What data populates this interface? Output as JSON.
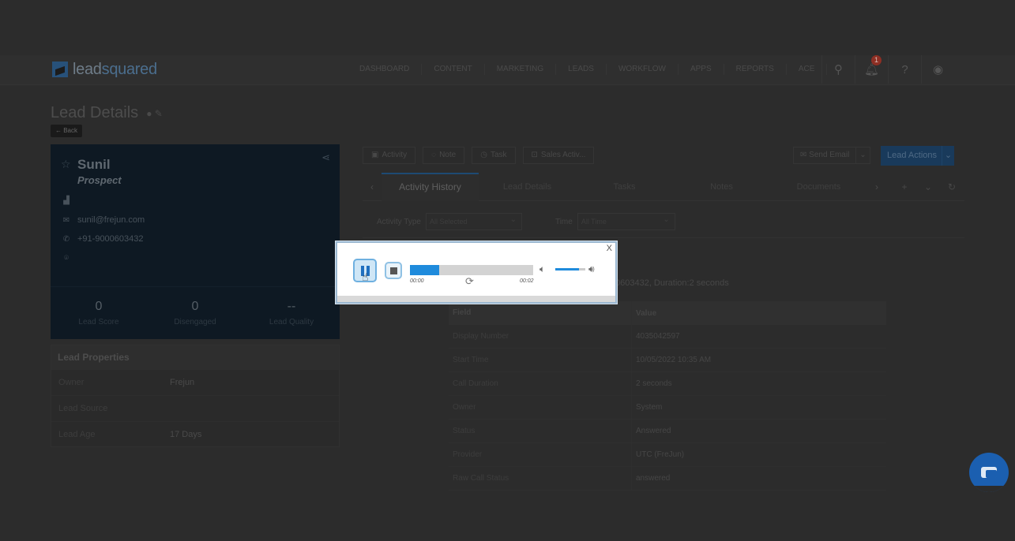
{
  "app": {
    "brand_left": "lead",
    "brand_right": "squared"
  },
  "nav": {
    "items": [
      "DASHBOARD",
      "CONTENT",
      "MARKETING",
      "LEADS",
      "WORKFLOW",
      "APPS",
      "REPORTS",
      "ACE"
    ],
    "notification_count": "1"
  },
  "page": {
    "title": "Lead Details",
    "back_label": "Back"
  },
  "lead": {
    "name": "Sunil",
    "stage": "Prospect",
    "email": "sunil@frejun.com",
    "phone": "+91-9000603432",
    "stats": [
      {
        "value": "0",
        "label": "Lead Score"
      },
      {
        "value": "0",
        "label": "Disengaged"
      },
      {
        "value": "--",
        "label": "Lead Quality"
      }
    ]
  },
  "properties": {
    "header": "Lead Properties",
    "rows": [
      {
        "label": "Owner",
        "value": "Frejun"
      },
      {
        "label": "Lead Source",
        "value": ""
      },
      {
        "label": "Lead Age",
        "value": "17 Days"
      }
    ]
  },
  "toolbar": {
    "activity": "Activity",
    "note": "Note",
    "task": "Task",
    "sales_activity": "Sales Activ...",
    "send_email": "Send Email",
    "lead_actions": "Lead Actions"
  },
  "tabs": [
    "Activity History",
    "Lead Details",
    "Tasks",
    "Notes",
    "Documents"
  ],
  "filters": {
    "activity_type_label": "Activity Type",
    "activity_type_value": "All Selected",
    "time_label": "Time",
    "time_value": "All Time"
  },
  "call": {
    "summary_fragment": "0603432, Duration:2 seconds",
    "table_header": {
      "field": "Field",
      "value": "Value"
    },
    "rows": [
      {
        "field": "Display Number",
        "value": "4035042597"
      },
      {
        "field": "Start Time",
        "value": "10/05/2022 10:35 AM"
      },
      {
        "field": "Call Duration",
        "value": "2 seconds"
      },
      {
        "field": "Owner",
        "value": "System"
      },
      {
        "field": "Status",
        "value": "Answered"
      },
      {
        "field": "Provider",
        "value": "UTC (FreJun)"
      },
      {
        "field": "Raw Call Status",
        "value": "answered"
      }
    ]
  },
  "player": {
    "close_label": "X",
    "time_current": "00:00",
    "time_total": "00:02",
    "progress": 0.24,
    "volume": 0.8,
    "accent_color": "#1f8bdc"
  }
}
